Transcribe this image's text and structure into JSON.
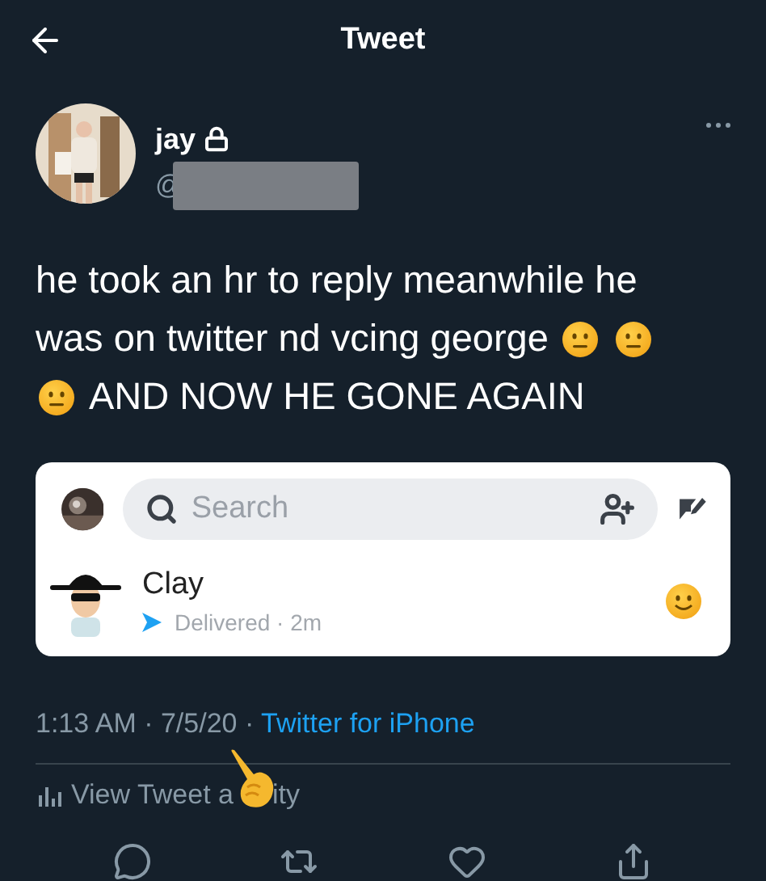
{
  "header": {
    "title": "Tweet"
  },
  "author": {
    "name": "jay",
    "protected": true,
    "handle_prefix": "@",
    "handle_redacted": true
  },
  "tweet": {
    "lines": [
      [
        {
          "kind": "text",
          "text": "he took an hr to reply meanwhile he"
        }
      ],
      [
        {
          "kind": "text",
          "text": "was on twitter nd vcing george"
        },
        {
          "kind": "emoji"
        },
        {
          "kind": "emoji"
        }
      ],
      [
        {
          "kind": "emoji"
        },
        {
          "kind": "text",
          "text": "AND NOW HE GONE AGAIN"
        }
      ]
    ]
  },
  "embedded_screenshot": {
    "search": {
      "placeholder": "Search"
    },
    "chats": [
      {
        "name": "Clay",
        "status": "Delivered · 2m"
      }
    ]
  },
  "meta": {
    "time": "1:13 AM · 7/5/20 · ",
    "source": "Twitter for iPhone"
  },
  "activity": {
    "before": "View Tweet a",
    "after": "ity"
  }
}
